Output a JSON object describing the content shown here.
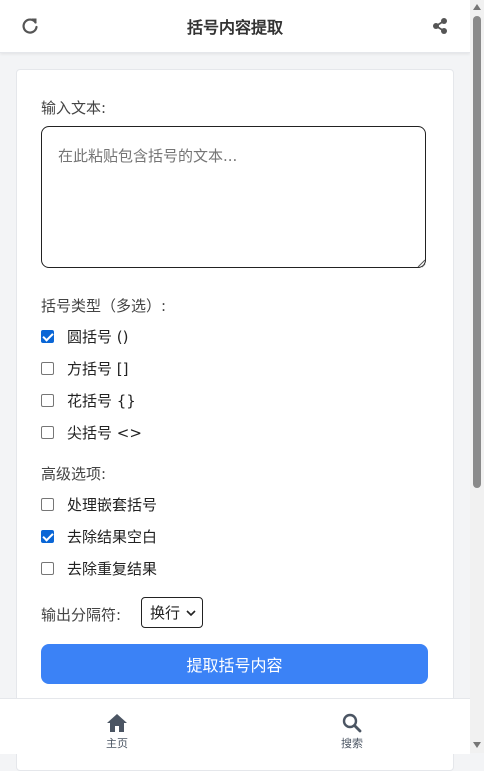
{
  "header": {
    "title": "括号内容提取",
    "refresh_icon": "refresh-icon",
    "share_icon": "share-icon"
  },
  "form": {
    "input_label": "输入文本:",
    "input_placeholder": "在此粘贴包含括号的文本...",
    "bracket_types_label": "括号类型（多选）:",
    "bracket_types": [
      {
        "label": "圆括号 ()",
        "checked": true
      },
      {
        "label": "方括号 []",
        "checked": false
      },
      {
        "label": "花括号 {}",
        "checked": false
      },
      {
        "label": "尖括号 <>",
        "checked": false
      }
    ],
    "advanced_label": "高级选项:",
    "advanced_options": [
      {
        "label": "处理嵌套括号",
        "checked": false
      },
      {
        "label": "去除结果空白",
        "checked": true
      },
      {
        "label": "去除重复结果",
        "checked": false
      }
    ],
    "separator_label": "输出分隔符:",
    "separator_value": "换行",
    "submit_label": "提取括号内容"
  },
  "bottom_nav": [
    {
      "label": "主页",
      "icon": "home-icon"
    },
    {
      "label": "搜索",
      "icon": "search-icon"
    }
  ],
  "colors": {
    "accent": "#3b82f6",
    "checkbox_checked": "#0a66d6"
  }
}
